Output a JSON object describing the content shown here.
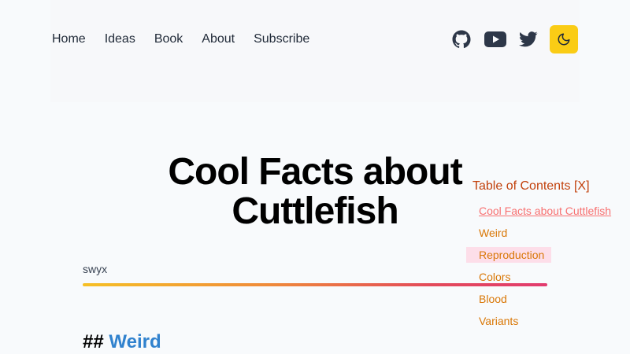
{
  "nav": {
    "items": [
      {
        "label": "Home"
      },
      {
        "label": "Ideas"
      },
      {
        "label": "Book"
      },
      {
        "label": "About"
      },
      {
        "label": "Subscribe"
      }
    ]
  },
  "social": {
    "icons": [
      "github-icon",
      "youtube-icon",
      "twitter-icon",
      "moon-icon"
    ],
    "theme_button_color": "#facc15"
  },
  "post": {
    "title": "Cool Facts about Cuttlefish",
    "author": "swyx",
    "heading_prefix": "##",
    "heading_label": "Weird"
  },
  "toc": {
    "title": "Table of Contents [X]",
    "items": [
      {
        "label": "Cool Facts about Cuttlefish"
      },
      {
        "label": "Weird"
      },
      {
        "label": "Reproduction"
      },
      {
        "label": "Colors"
      },
      {
        "label": "Blood"
      },
      {
        "label": "Variants"
      }
    ]
  },
  "colors": {
    "link_blue": "#3182ce",
    "toc_title": "#c2410c",
    "toc_link": "#d97706",
    "toc_active": "#f87171"
  }
}
